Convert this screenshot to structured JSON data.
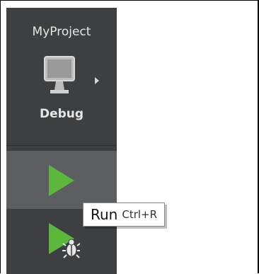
{
  "sidebar": {
    "project_name": "MyProject",
    "target_icon": "monitor-icon",
    "build_config": "Debug",
    "run_icon": "play-icon",
    "debug_run_icon": "play-bug-icon"
  },
  "tooltip": {
    "title": "Run",
    "shortcut": "Ctrl+R"
  },
  "colors": {
    "sidebar_bg": "#3e3f40",
    "run_button_hover": "#5d5e5f",
    "play_green": "#5bb83a"
  }
}
